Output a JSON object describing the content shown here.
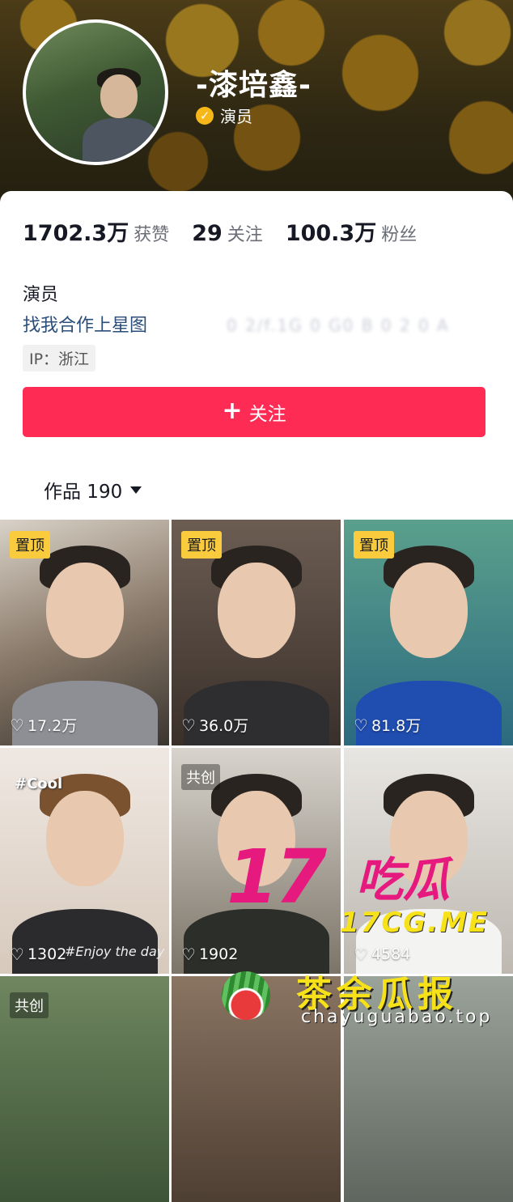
{
  "profile": {
    "name": "-漆培鑫-",
    "verification": "演员",
    "verification_icon": "check-badge-icon",
    "accent_color": "#fe2c55"
  },
  "stats": [
    {
      "value": "1702.3万",
      "label": "获赞"
    },
    {
      "value": "29",
      "label": "关注"
    },
    {
      "value": "100.3万",
      "label": "粉丝"
    }
  ],
  "bio": {
    "line1": "演员",
    "line2": "找我合作上星图",
    "blurred": "(blurred text)",
    "ip": "IP：浙江"
  },
  "follow_button": {
    "label": "关注",
    "icon": "plus-icon"
  },
  "works_tab": {
    "label": "作品 190",
    "icon": "caret-down-icon"
  },
  "videos": [
    {
      "tag": "置顶",
      "likes": "17.2万"
    },
    {
      "tag": "置顶",
      "likes": "36.0万"
    },
    {
      "tag": "置顶",
      "likes": "81.8万"
    },
    {
      "tag": "",
      "likes": "1302",
      "overlay_top": "#Cool",
      "overlay_bottom": "#Enjoy the day"
    },
    {
      "tag": "共创",
      "likes": "1902"
    },
    {
      "tag": "",
      "likes": "4584"
    },
    {
      "tag": "共创",
      "likes": ""
    },
    {
      "tag": "",
      "likes": ""
    },
    {
      "tag": "",
      "likes": ""
    }
  ],
  "watermark": {
    "big": "17",
    "big2": "吃瓜",
    "domain1": "17CG.ME",
    "brand": "茶余瓜报",
    "domain2": "chayuguabao.top"
  }
}
